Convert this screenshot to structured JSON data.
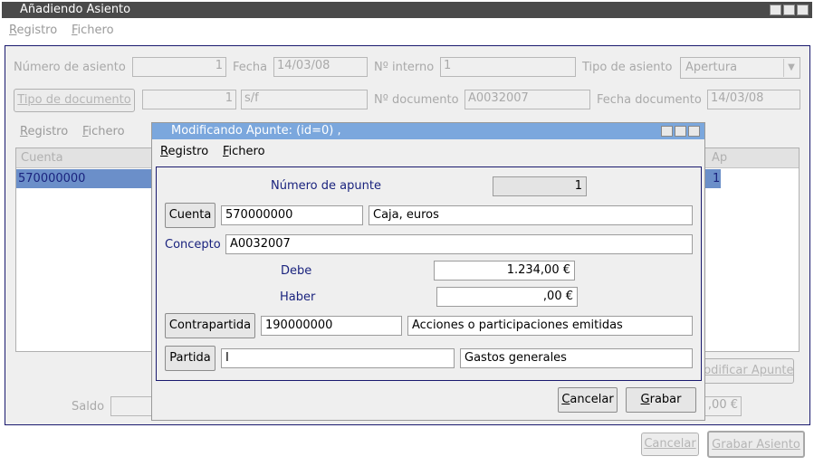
{
  "window": {
    "title": "Añadiendo Asiento",
    "menu": [
      "Registro",
      "Fichero"
    ]
  },
  "asiento": {
    "numero_label": "Número de asiento",
    "numero_value": "1",
    "fecha_label": "Fecha",
    "fecha_value": "14/03/08",
    "interno_label": "Nº interno",
    "interno_value": "1",
    "tipo_label": "Tipo de asiento",
    "tipo_value": "Apertura",
    "tipo_doc_button": "Tipo de documento",
    "tipo_doc_num": "1",
    "tipo_doc_code": "s/f",
    "documento_label": "Nº documento",
    "documento_value": "A0032007",
    "fecha_doc_label": "Fecha documento",
    "fecha_doc_value": "14/03/08"
  },
  "inner_menu": [
    "Registro",
    "Fichero"
  ],
  "table": {
    "header_cuenta": "Cuenta",
    "header_right": "Ap",
    "row_cuenta": "570000000",
    "row_right": "1"
  },
  "bottom": {
    "saldo_label": "Saldo",
    "saldo_right": ",00 €",
    "modificar_button": "Modificar Apunte",
    "cancelar_button": "Cancelar",
    "grabar_button": "Grabar Asiento"
  },
  "dialog": {
    "title": "Modificando Apunte: (id=0) ,",
    "menu": [
      "Registro",
      "Fichero"
    ],
    "numero_label": "Número de apunte",
    "numero_value": "1",
    "cuenta_button": "Cuenta",
    "cuenta_value": "570000000",
    "cuenta_desc": "Caja, euros",
    "concepto_label": "Concepto",
    "concepto_value": "A0032007",
    "debe_label": "Debe",
    "debe_value": "1.234,00 €",
    "haber_label": "Haber",
    "haber_value": ",00 €",
    "contrapartida_button": "Contrapartida",
    "contrapartida_value": "190000000",
    "contrapartida_desc": "Acciones o participaciones emitidas",
    "partida_button": "Partida",
    "partida_value": "I",
    "partida_desc": "Gastos generales",
    "cancelar_button": "Cancelar",
    "grabar_button": "Grabar"
  },
  "colors": {
    "accent": "#7ba7dd",
    "selection": "#6b8fc9",
    "label_blue": "#1a237e"
  }
}
